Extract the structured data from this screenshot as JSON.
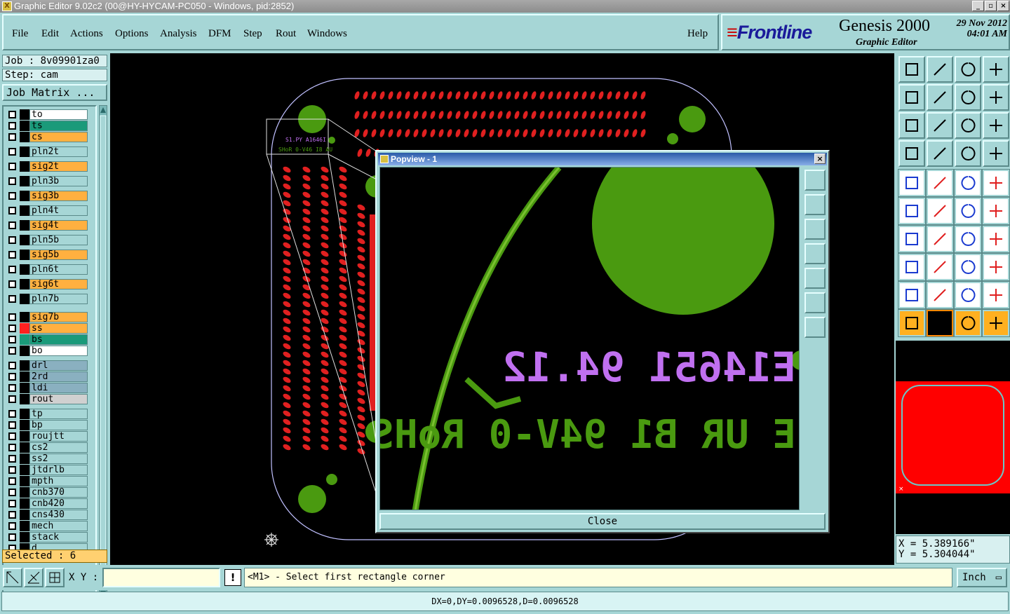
{
  "window": {
    "title": "Graphic Editor 9.02c2 (00@HY-HYCAM-PC050 - Windows, pid:2852)"
  },
  "menu": [
    "File",
    "Edit",
    "Actions",
    "Options",
    "Analysis",
    "DFM",
    "Step",
    "Rout",
    "Windows"
  ],
  "help": "Help",
  "brand": {
    "logo": "Frontline",
    "product": "Genesis 2000",
    "subtitle": "Graphic Editor",
    "date": "29 Nov 2012",
    "time": "04:01 AM"
  },
  "job": {
    "job": "Job : 8v09901za0",
    "step": "Step: cam",
    "matrix_button": "Job Matrix ..."
  },
  "layers": [
    {
      "name": "to",
      "bg": "#ffffff",
      "sw": "#000000"
    },
    {
      "name": "ts",
      "bg": "#1a9a7a",
      "sw": "#000000"
    },
    {
      "name": "cs",
      "bg": "#ffb040",
      "sw": "#000000"
    },
    {
      "name": "pln2t",
      "bg": "#a6d6d6",
      "sw": "#000000"
    },
    {
      "name": "sig2t",
      "bg": "#ffb040",
      "sw": "#000000"
    },
    {
      "name": "pln3b",
      "bg": "#a6d6d6",
      "sw": "#000000"
    },
    {
      "name": "sig3b",
      "bg": "#ffb040",
      "sw": "#000000"
    },
    {
      "name": "pln4t",
      "bg": "#a6d6d6",
      "sw": "#000000"
    },
    {
      "name": "sig4t",
      "bg": "#ffb040",
      "sw": "#000000"
    },
    {
      "name": "pln5b",
      "bg": "#a6d6d6",
      "sw": "#000000"
    },
    {
      "name": "sig5b",
      "bg": "#ffb040",
      "sw": "#000000"
    },
    {
      "name": "pln6t",
      "bg": "#a6d6d6",
      "sw": "#000000"
    },
    {
      "name": "sig6t",
      "bg": "#ffb040",
      "sw": "#000000"
    },
    {
      "name": "pln7b",
      "bg": "#a6d6d6",
      "sw": "#000000"
    },
    {
      "name": "sig7b",
      "bg": "#ffb040",
      "sw": "#000000"
    },
    {
      "name": "ss",
      "bg": "#ffb040",
      "sw": "#ff2020"
    },
    {
      "name": "bs",
      "bg": "#1a9a7a",
      "sw": "#1a9a7a"
    },
    {
      "name": "bo",
      "bg": "#ffffff",
      "sw": "#000000"
    },
    {
      "name": "drl",
      "bg": "#8ab0c0",
      "sw": "#000000"
    },
    {
      "name": "2rd",
      "bg": "#8ab0c0",
      "sw": "#000000"
    },
    {
      "name": "ldi",
      "bg": "#8ab0c0",
      "sw": "#000000"
    },
    {
      "name": "rout",
      "bg": "#d0d0d0",
      "sw": "#000000"
    },
    {
      "name": "tp",
      "bg": "#a6d6d6",
      "sw": "#000000"
    },
    {
      "name": "bp",
      "bg": "#a6d6d6",
      "sw": "#000000"
    },
    {
      "name": "roujtt",
      "bg": "#a6d6d6",
      "sw": "#000000"
    },
    {
      "name": "cs2",
      "bg": "#a6d6d6",
      "sw": "#000000"
    },
    {
      "name": "ss2",
      "bg": "#a6d6d6",
      "sw": "#000000"
    },
    {
      "name": "jtdrlb",
      "bg": "#a6d6d6",
      "sw": "#000000"
    },
    {
      "name": "mpth",
      "bg": "#a6d6d6",
      "sw": "#000000"
    },
    {
      "name": "cnb370",
      "bg": "#a6d6d6",
      "sw": "#000000"
    },
    {
      "name": "cnb420",
      "bg": "#a6d6d6",
      "sw": "#000000"
    },
    {
      "name": "cns430",
      "bg": "#a6d6d6",
      "sw": "#000000"
    },
    {
      "name": "mech",
      "bg": "#a6d6d6",
      "sw": "#000000"
    },
    {
      "name": "stack",
      "bg": "#a6d6d6",
      "sw": "#000000"
    },
    {
      "name": "d",
      "bg": "#a6d6d6",
      "sw": "#000000"
    }
  ],
  "selected": "Selected : 6",
  "popup": {
    "title": "Popview - 1",
    "close_label": "Close",
    "text_purple": "E14651 94.12",
    "text_green": "E UR B1 94V-0 RoHS"
  },
  "command": {
    "xy_label": "X Y :",
    "xy_value": "",
    "prompt": "<M1> - Select first rectangle corner",
    "unit": "Inch"
  },
  "coords": {
    "x": "X = 5.389166\"",
    "y": "Y = 5.304044\""
  },
  "status": "DX=0,DY=0.0096528,D=0.0096528",
  "colors": {
    "accent": "#a6d6d6",
    "copper": "#4a9a10",
    "pad_red": "#e02020",
    "pad_yellow": "#e0b020",
    "text_purple": "#c070f0"
  }
}
